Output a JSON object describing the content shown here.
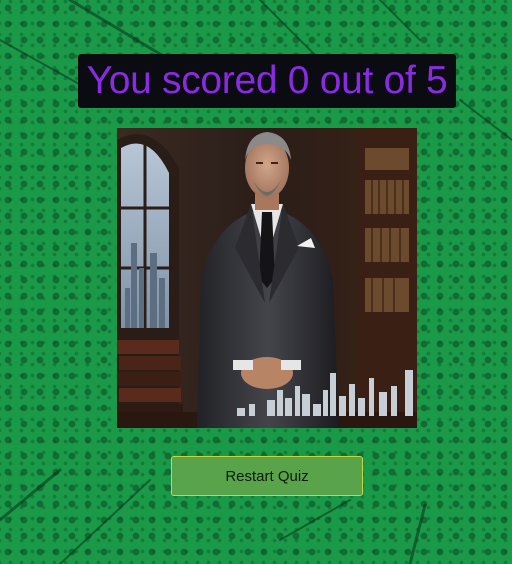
{
  "result": {
    "score_text": "You scored 0 out of 5"
  },
  "image": {
    "subject": "businessman-portrait"
  },
  "actions": {
    "restart_label": "Restart Quiz"
  },
  "colors": {
    "background": "#1a9a48",
    "score_text": "#8a2be2",
    "score_box": "#0b0b12",
    "button_bg": "#59a44a",
    "button_border": "#c8d83a"
  }
}
